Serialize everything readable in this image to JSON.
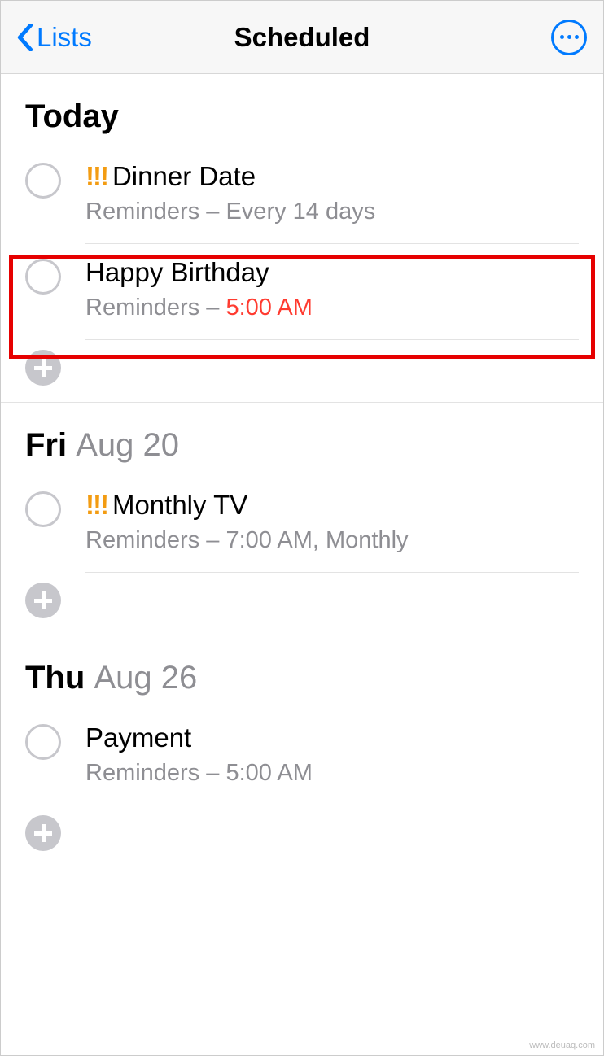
{
  "header": {
    "back_label": "Lists",
    "title": "Scheduled"
  },
  "sections": [
    {
      "weekday": "Today",
      "date": "",
      "items": [
        {
          "priority": "!!!",
          "title": "Dinner Date",
          "list": "Reminders",
          "detail": "Every 14 days",
          "overdue": false
        },
        {
          "priority": "",
          "title": "Happy Birthday",
          "list": "Reminders",
          "detail": "5:00 AM",
          "overdue": true
        }
      ]
    },
    {
      "weekday": "Fri",
      "date": "Aug 20",
      "items": [
        {
          "priority": "!!!",
          "title": "Monthly  TV",
          "list": "Reminders",
          "detail": "7:00 AM, Monthly",
          "overdue": false
        }
      ]
    },
    {
      "weekday": "Thu",
      "date": "Aug 26",
      "items": [
        {
          "priority": "",
          "title": "Payment",
          "list": "Reminders",
          "detail": "5:00 AM",
          "overdue": false
        }
      ]
    }
  ],
  "watermark": "www.deuaq.com"
}
